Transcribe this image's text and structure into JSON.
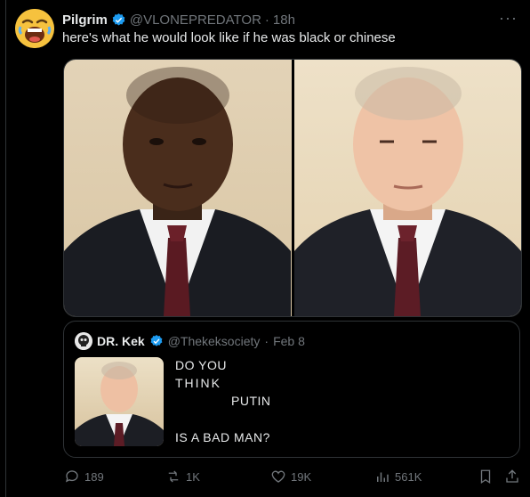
{
  "tweet": {
    "author_name": "Pilgrim",
    "handle": "@VLONEPREDATOR",
    "separator": "·",
    "time": "18h",
    "more_label": "···",
    "text": "here's what he would look like if he was black or chinese"
  },
  "quoted": {
    "author_name": "DR. Kek",
    "handle": "@Thekeksociety",
    "separator": "·",
    "date": "Feb 8",
    "lines": [
      "DO YOU",
      "THINK",
      "PUTIN",
      "IS A BAD MAN?"
    ]
  },
  "actions": {
    "replies": "189",
    "reposts": "1K",
    "likes": "19K",
    "views": "561K"
  },
  "icons": {
    "verified": "verified-badge-icon",
    "reply": "reply-icon",
    "repost": "repost-icon",
    "like": "heart-icon",
    "views": "views-icon",
    "bookmark": "bookmark-icon",
    "share": "share-icon"
  },
  "colors": {
    "background": "#000000",
    "text": "#e7e9ea",
    "muted": "#71767b",
    "border": "#2f3336",
    "verified": "#1d9bf0"
  }
}
